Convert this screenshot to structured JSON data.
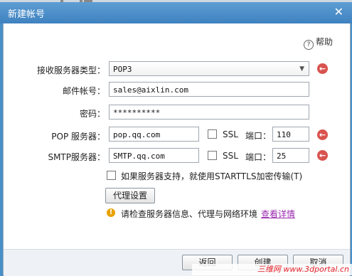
{
  "window": {
    "title": "新建帐号"
  },
  "help_label": "帮助",
  "fields": {
    "receive_type_label": "接收服务器类型：",
    "receive_type_value": "POP3",
    "email_label": "邮件帐号：",
    "email_value": "sales@aixlin.com",
    "password_label": "密码：",
    "password_value": "**********",
    "pop_label": "POP 服务器：",
    "pop_value": "pop.qq.com",
    "pop_ssl_label": "SSL",
    "pop_port_label": "端口：",
    "pop_port_value": "110",
    "smtp_label": "SMTP服务器：",
    "smtp_value": "SMTP.qq.com",
    "smtp_ssl_label": "SSL",
    "smtp_port_label": "端口：",
    "smtp_port_value": "25"
  },
  "starttls_label": "如果服务器支持，就使用STARTTLS加密传输(T)",
  "proxy_button": "代理设置",
  "warning": {
    "text": "请检查服务器信息、代理与网络环境",
    "link": "查看详情"
  },
  "buttons": {
    "back": "返回",
    "create": "创建",
    "cancel": "取消"
  },
  "watermark": "三维网 www.3dportal.cn",
  "colors": {
    "titlebar": "#4a8cc8",
    "accent_red": "#d9534f",
    "warning": "#e8a200",
    "link": "#9c2bb0"
  },
  "icons": [
    "help-icon",
    "close-icon",
    "arrow-left-icon",
    "warning-icon",
    "chevron-down-icon"
  ]
}
